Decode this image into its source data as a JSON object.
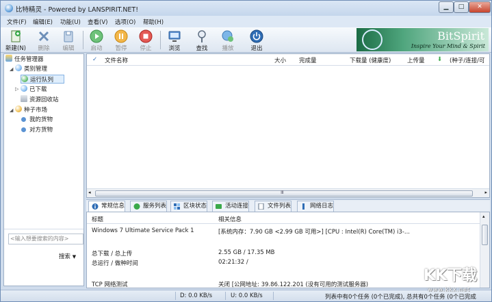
{
  "window": {
    "title": "比特精灵 - Powered by LANSPIRIT.NET!"
  },
  "menu": [
    "文件(F)",
    "编辑(E)",
    "功能(U)",
    "查看(V)",
    "选项(O)",
    "帮助(H)"
  ],
  "toolbar": [
    {
      "label": "新建(N)",
      "icon": "new-icon",
      "enabled": true
    },
    {
      "label": "删除",
      "icon": "delete-icon",
      "enabled": false
    },
    {
      "label": "编辑",
      "icon": "edit-icon",
      "enabled": false
    },
    {
      "label": "启动",
      "icon": "start-icon",
      "enabled": false
    },
    {
      "label": "暂停",
      "icon": "pause-icon",
      "enabled": false
    },
    {
      "label": "停止",
      "icon": "stop-icon",
      "enabled": false
    },
    {
      "label": "浏览",
      "icon": "browse-icon",
      "enabled": true
    },
    {
      "label": "查找",
      "icon": "find-icon",
      "enabled": true
    },
    {
      "label": "播放",
      "icon": "play-icon",
      "enabled": false
    },
    {
      "label": "退出",
      "icon": "exit-icon",
      "enabled": true
    }
  ],
  "brand": {
    "name": "BitSpirit",
    "slogan": "Inspire Your Mind & Spirit"
  },
  "tree": [
    {
      "label": "任务管理器",
      "level": 0,
      "icon": "task-manager-icon",
      "expander": ""
    },
    {
      "label": "类别管理",
      "level": 1,
      "icon": "category-icon",
      "expander": "◢"
    },
    {
      "label": "运行队列",
      "level": 2,
      "icon": "running-queue-icon",
      "expander": "",
      "selected": true
    },
    {
      "label": "已下载",
      "level": 2,
      "icon": "downloaded-icon",
      "expander": "▷"
    },
    {
      "label": "资源回收站",
      "level": 2,
      "icon": "recycle-bin-icon",
      "expander": ""
    },
    {
      "label": "种子市场",
      "level": 1,
      "icon": "torrent-market-icon",
      "expander": "◢"
    },
    {
      "label": "我的货物",
      "level": 2,
      "icon": "my-goods-icon",
      "expander": ""
    },
    {
      "label": "对方货物",
      "level": 2,
      "icon": "peer-goods-icon",
      "expander": ""
    }
  ],
  "search": {
    "placeholder": "<输入想要搜索的内容>",
    "button": "搜索"
  },
  "grid": {
    "check": "✓",
    "columns": [
      "文件名称",
      "大小",
      "完成量",
      "下载量 (健康度)",
      "上传量",
      "(种子/连接/可"
    ],
    "hscroll_grip": "Ⅲ"
  },
  "tabs": [
    {
      "label": "常规信息",
      "icon": "info-icon",
      "active": true
    },
    {
      "label": "服务列表",
      "icon": "server-list-icon"
    },
    {
      "label": "区块状态",
      "icon": "block-status-icon"
    },
    {
      "label": "活动连接",
      "icon": "active-connections-icon"
    },
    {
      "label": "文件列表",
      "icon": "file-list-icon"
    },
    {
      "label": "网络日志",
      "icon": "network-log-icon"
    }
  ],
  "info": {
    "header": {
      "key": "标题",
      "value": "相关信息"
    },
    "rows": [
      {
        "key": "Windows 7 Ultimate Service Pack 1",
        "value": "[系统内存：7.90 GB <2.99 GB 可用>] [CPU : Intel(R) Core(TM) i3-..."
      },
      {
        "key": "",
        "value": ""
      },
      {
        "key": "总下载 / 总上传",
        "value": "2.55 GB / 17.35 MB"
      },
      {
        "key": "总运行 / 做种时间",
        "value": "02:21:32 /"
      },
      {
        "key": "",
        "value": ""
      },
      {
        "key": "TCP 网络测试",
        "value": "关闭 [公网地址: 39.86.122.201 (没有可用的测试服务器)"
      }
    ]
  },
  "status": {
    "download": "D: 0.0 KB/s",
    "upload": "U: 0.0 KB/s",
    "summary": "列表中有0个任务 (0个已完成), 总共有0个任务 (0个已完成"
  },
  "watermark": {
    "text": "KK下载",
    "sub": "www.kkx.net"
  },
  "colors": {
    "accent": "#3a76b8",
    "brand_green": "#1b6c45",
    "start": "#3aa94a",
    "pause": "#f0a21f",
    "stop": "#d9322b"
  }
}
